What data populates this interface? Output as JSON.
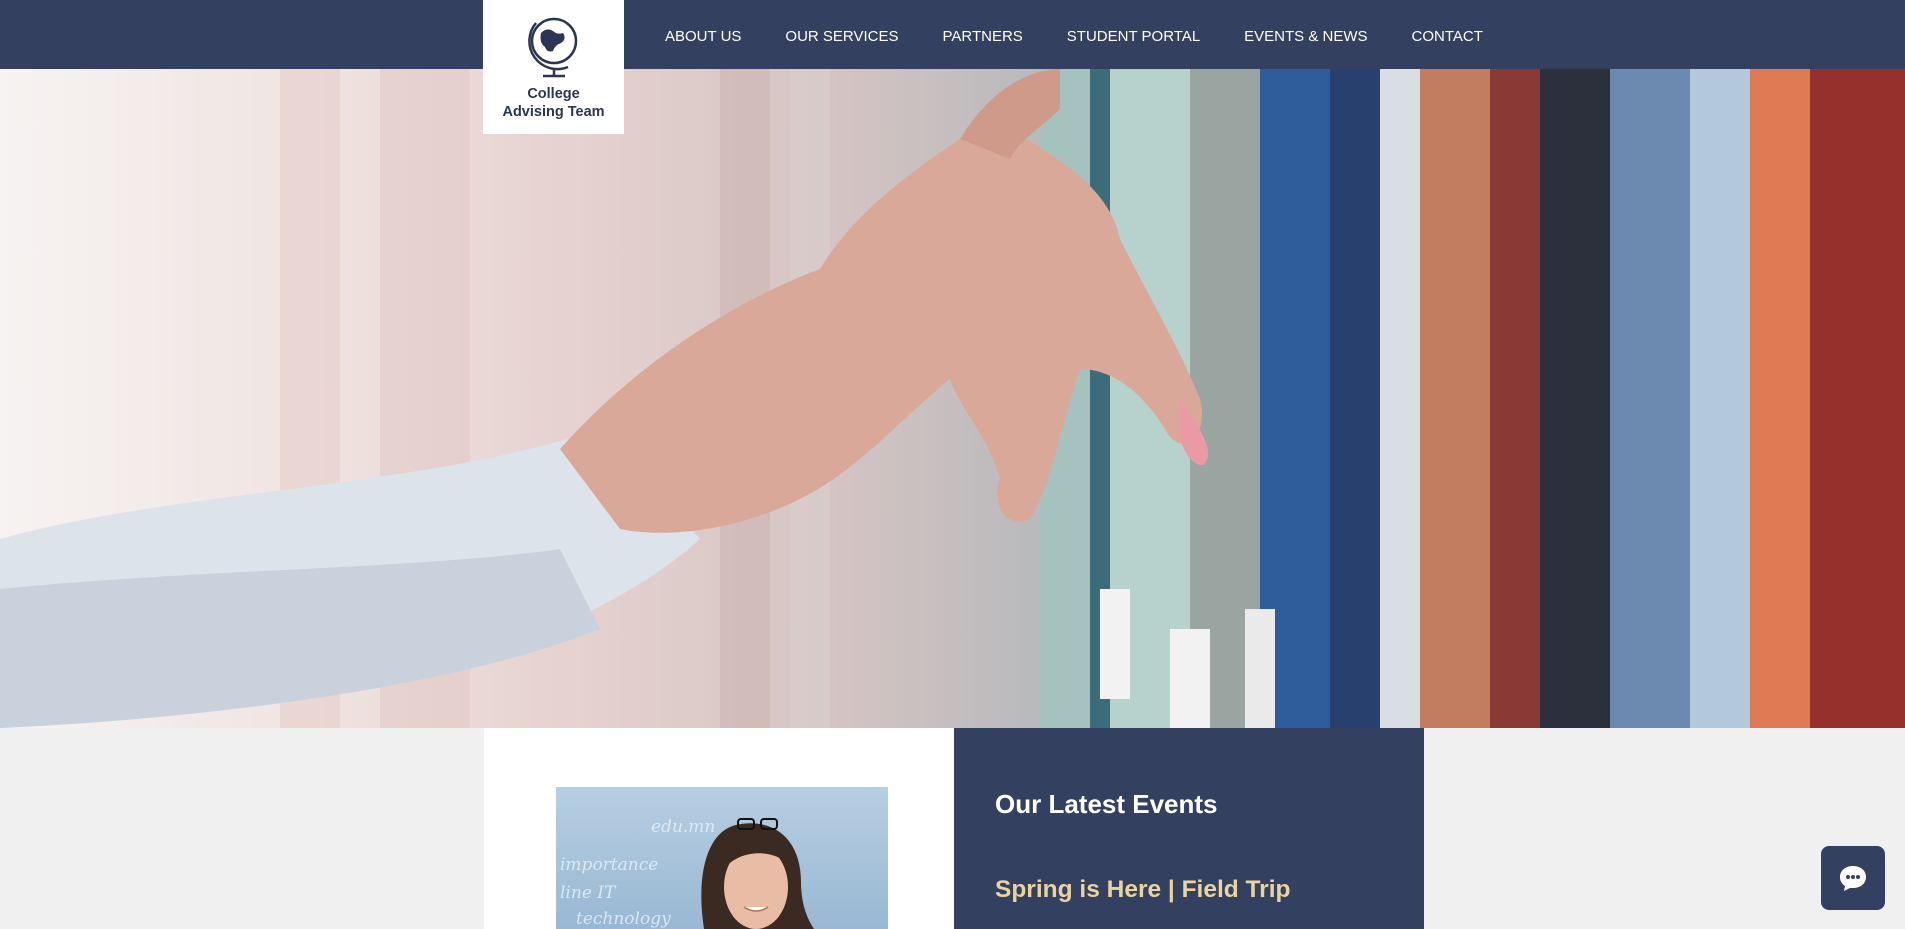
{
  "logo": {
    "line1": "College",
    "line2": "Advising Team",
    "icon": "globe-icon"
  },
  "nav": {
    "items": [
      "ABOUT US",
      "OUR SERVICES",
      "PARTNERS",
      "STUDENT PORTAL",
      "EVENTS & NEWS",
      "CONTACT"
    ]
  },
  "events": {
    "title": "Our Latest Events",
    "items": [
      "Spring is Here | Field Trip"
    ]
  },
  "chat": {
    "icon": "chat-bubble-icon"
  },
  "colors": {
    "primary": "#344060",
    "accent": "#e9d49c",
    "background": "#f0f0f0"
  }
}
